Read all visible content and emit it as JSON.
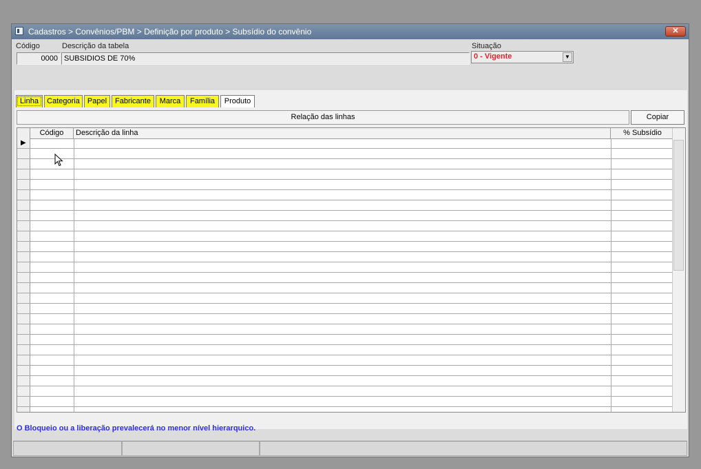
{
  "window": {
    "title": "Cadastros > Convênios/PBM > Definição por produto > Subsídio do convênio",
    "close_label": "✕"
  },
  "header": {
    "codigo_label": "Código",
    "codigo_value": "0000",
    "descricao_label": "Descrição da tabela",
    "descricao_value": "SUBSIDIOS DE 70%",
    "situacao_label": "Situação",
    "situacao_value": "0 - Vigente"
  },
  "tabs": [
    {
      "label": "Linha"
    },
    {
      "label": "Categoria"
    },
    {
      "label": "Papel"
    },
    {
      "label": "Fabricante"
    },
    {
      "label": "Marca"
    },
    {
      "label": "Família"
    },
    {
      "label": "Produto"
    }
  ],
  "toolbar": {
    "relacao_label": "Relação das linhas",
    "copiar_label": "Copiar"
  },
  "grid": {
    "columns": [
      "Código",
      "Descrição da linha",
      "% Subsídio"
    ],
    "current_row_marker": "▶"
  },
  "footer_note": "O Bloqueio ou a liberação prevalecerá no menor nível hierarquico.",
  "colors": {
    "tab_highlight": "#f7f71e",
    "situacao_text": "#e0242c",
    "note_text": "#2c2ce0"
  },
  "icons": [
    "app-icon",
    "close-icon",
    "dropdown-arrow-icon",
    "row-pointer-icon",
    "mouse-cursor-icon"
  ]
}
